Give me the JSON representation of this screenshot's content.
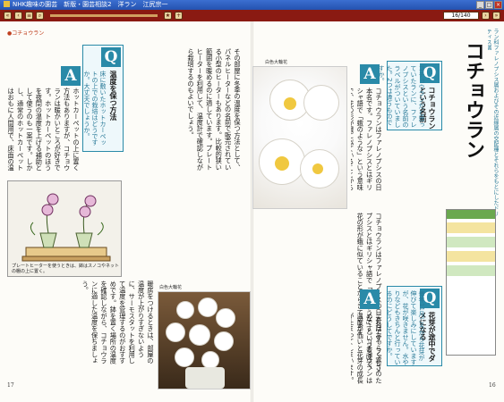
{
  "window": {
    "title": "NHK趣味の園芸　新版・園芸相談2　洋ラン　江尻宗一"
  },
  "toolbar": {
    "page_indicator": "16/140"
  },
  "left_page": {
    "section_tag": "●コチョウラン",
    "q_title": "温度を保つ方法",
    "q_text": "床に敷いたホットカーペットの上での栽培はどうですか。大丈夫でしょうか。",
    "a_text": "ホットカーペットの上に置く方法もありますが、コチョウランは暖かいところが好きです。ホットカーペットのほうを夜間の温度を上げる補助として使うのも一案です。しかし、通常のホットカーペットはおもに人間用で、床面の温度はかなり高くなることがありますから、乾燥には十分な注意が必要です。",
    "col2": "その部屋に冬季の温度を保つ方法として、パネルヒーターなどの名前で販売されている小型のヒーターもあります。比較的狭い範囲を暖めるのに適しています。プレートヒーターを利用して、温度計で確認しながら栽培するのもよいでしょう。",
    "col3": "暖房をつけるときは、部屋の温度が上がりすぎないように、サーモスタットを利用して温度を管理するのがおすすめです。鉢を置く場所の温度を確認しながら、コチョウランに適した温度を保ちましょう。",
    "illustration_caption": "プレートヒーターを使うときは、鉢はスノコやネットの棚の上に置く。",
    "photo_caption": "白色大輪花",
    "page_number": "17"
  },
  "right_page": {
    "running_head": "ラン科ファレノプシス属およびその近縁属の交配種とそれらをもとにしたドリティス属",
    "heading": "コチョウラン",
    "q1_title": "コチョウランという名前",
    "q1_text": "コチョウランだと思っていたランに、ファレノプシスという名前のラベルがついていました。2つは違うものですか。",
    "a1_text": "コチョウランはファレノプシスの日本名です。ファレノプシスとはギリシャ語で「蛾のような」という意味で、花の形が蛾に似ていることからきています。",
    "q2_title": "花芽が途中でダメになる",
    "q2_text": "毎年11月ごろから花芽が伸びて楽しみにしていますが、花が咲きません。水やりなどもきちんと行っているのにどうしてですか。",
    "a2_text": "これはおそらく寒さのためです。コチョウランは温度が低いと花芽の成長が止まってしまいます。",
    "photo_caption": "白色大輪花",
    "page_number": "16"
  }
}
